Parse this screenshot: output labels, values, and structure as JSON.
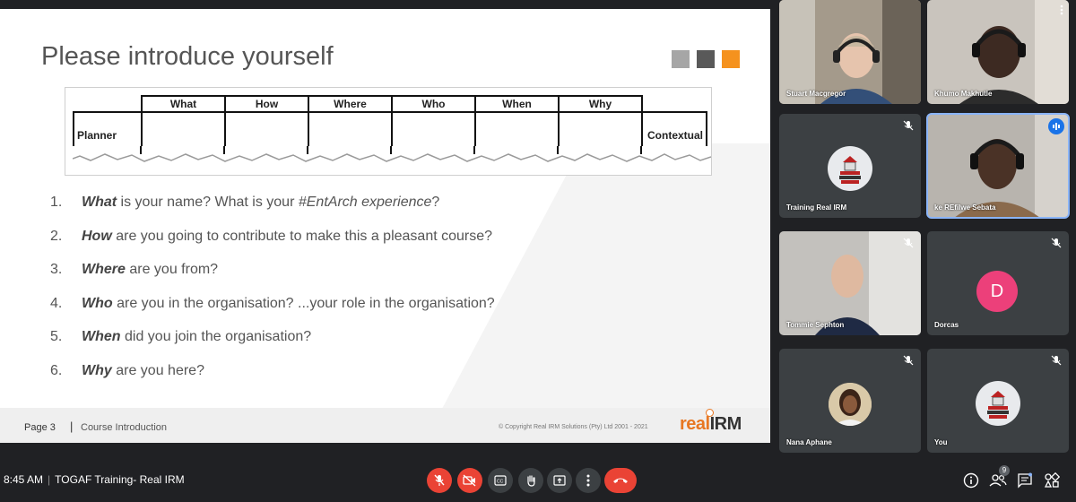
{
  "slide": {
    "title": "Please introduce yourself",
    "square_colors": [
      "#a6a6a6",
      "#595959",
      "#f5921e"
    ],
    "table": {
      "columns": [
        "What",
        "How",
        "Where",
        "Who",
        "When",
        "Why"
      ],
      "row_label": "Planner",
      "right_label": "Contextual"
    },
    "questions": [
      {
        "num": "1.",
        "key": "What",
        "rest": " is your name? What is your ",
        "emph": "#EntArch experience",
        "end": "?"
      },
      {
        "num": "2.",
        "key": "How",
        "rest": " are you going to contribute to make this a pleasant course?",
        "emph": "",
        "end": ""
      },
      {
        "num": "3.",
        "key": "Where",
        "rest": " are you from?",
        "emph": "",
        "end": ""
      },
      {
        "num": "4.",
        "key": "Who",
        "rest": " are you in the organisation? ...your role in the organisation?",
        "emph": "",
        "end": ""
      },
      {
        "num": "5.",
        "key": "When",
        "rest": " did you join the organisation?",
        "emph": "",
        "end": ""
      },
      {
        "num": "6.",
        "key": "Why",
        "rest": " are you here?",
        "emph": "",
        "end": ""
      }
    ],
    "footer": {
      "page": "Page 3",
      "separator": "|",
      "section": "Course Introduction",
      "copyright": "© Copyright Real IRM Solutions (Pty) Ltd 2001 - 2021",
      "logo_real": "real",
      "logo_irm": "IRM"
    }
  },
  "participants": [
    {
      "name": "Stuart Macgregor",
      "type": "video",
      "muted": false
    },
    {
      "name": "Khumo Makhutle",
      "type": "video",
      "muted": false
    },
    {
      "name": "Training Real IRM",
      "type": "logo",
      "muted": true
    },
    {
      "name": "ke REfilwe Sebata",
      "type": "video",
      "speaking": true
    },
    {
      "name": "Tommie Sephton",
      "type": "video",
      "muted": true
    },
    {
      "name": "Dorcas",
      "type": "letter",
      "letter": "D",
      "muted": true
    },
    {
      "name": "Nana Aphane",
      "type": "photo",
      "muted": true
    },
    {
      "name": "You",
      "type": "logo",
      "muted": true
    }
  ],
  "bottombar": {
    "time": "8:45 AM",
    "separator": "|",
    "meeting_title": "TOGAF Training- Real IRM",
    "people_count": "9",
    "icons": [
      "mic-off-icon",
      "camera-off-icon",
      "captions-icon",
      "raise-hand-icon",
      "present-icon",
      "more-icon",
      "hang-up-icon",
      "info-icon",
      "people-icon",
      "chat-icon",
      "activities-icon"
    ]
  },
  "colors": {
    "accent_orange": "#f5921e",
    "meet_red": "#ea4335",
    "meet_bg": "#202124",
    "tile_bg": "#3c4043",
    "speaking_blue": "#1a73e8"
  }
}
